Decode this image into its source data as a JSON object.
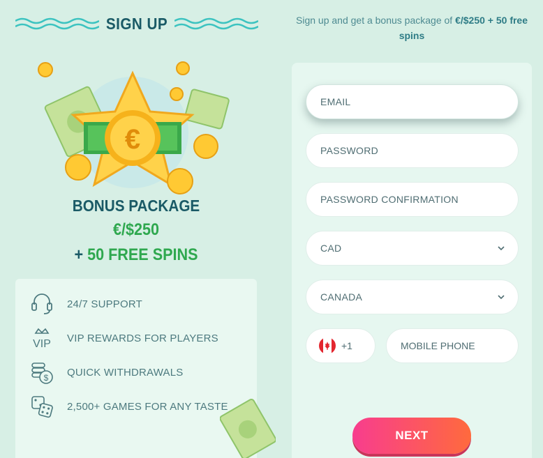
{
  "header": {
    "title": "SIGN UP"
  },
  "promo": {
    "text_prefix": "Sign up and get a bonus package of ",
    "text_bold": "€/$250 + 50 free spins"
  },
  "bonus": {
    "title": "BONUS PACKAGE",
    "amount": "€/$250",
    "spins_plus": "+",
    "spins": "50 FREE SPINS"
  },
  "features": [
    {
      "icon": "headset-icon",
      "label": "24/7 SUPPORT"
    },
    {
      "icon": "vip-crown-icon",
      "label": "VIP REWARDS FOR PLAYERS"
    },
    {
      "icon": "coins-stack-icon",
      "label": "QUICK WITHDRAWALS"
    },
    {
      "icon": "dice-icon",
      "label": "2,500+ GAMES FOR ANY TASTE"
    }
  ],
  "form": {
    "email_placeholder": "EMAIL",
    "password_placeholder": "PASSWORD",
    "password_confirm_placeholder": "PASSWORD CONFIRMATION",
    "currency_value": "CAD",
    "country_value": "CANADA",
    "phone_code": "+1",
    "phone_placeholder": "MOBILE PHONE",
    "next_label": "NEXT"
  },
  "colors": {
    "background": "#d7efe5",
    "heading": "#1a5a66",
    "accent_green": "#2fa84f",
    "button_start": "#f83d8e",
    "button_end": "#ff6a3d"
  }
}
